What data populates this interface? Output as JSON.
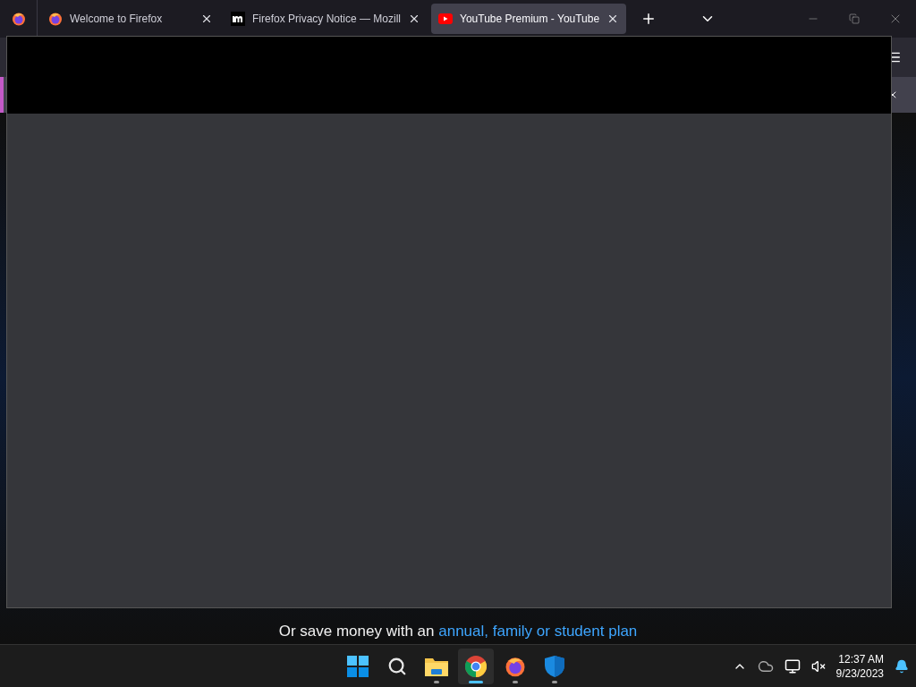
{
  "tabs": [
    {
      "title": "Welcome to Firefox",
      "kind": "firefox",
      "selected": false
    },
    {
      "title": "Firefox Privacy Notice — Mozill",
      "kind": "mozilla",
      "selected": false
    },
    {
      "title": "YouTube Premium - YouTube",
      "kind": "youtube",
      "selected": true
    }
  ],
  "page": {
    "footer_text": "Or save money with an ",
    "footer_link": "annual, family or student plan"
  },
  "taskbar": {
    "apps": [
      {
        "kind": "start",
        "running": false,
        "selected": false
      },
      {
        "kind": "search",
        "running": false,
        "selected": false
      },
      {
        "kind": "folder",
        "running": true,
        "selected": false
      },
      {
        "kind": "chrome",
        "running": true,
        "selected": true
      },
      {
        "kind": "firefox",
        "running": true,
        "selected": false
      },
      {
        "kind": "shield",
        "running": true,
        "selected": false
      }
    ],
    "time": "12:37 AM",
    "date": "9/23/2023"
  }
}
